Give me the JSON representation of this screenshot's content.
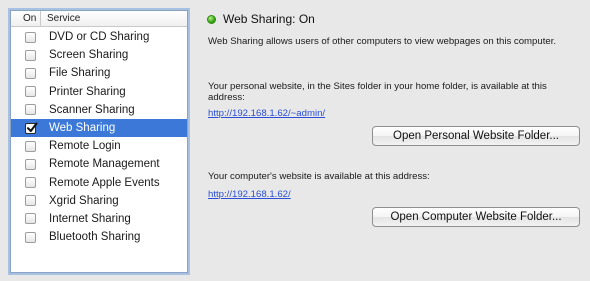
{
  "services_list": {
    "header": {
      "on_label": "On",
      "service_label": "Service"
    },
    "items": [
      {
        "label": "DVD or CD Sharing",
        "checked": false,
        "selected": false
      },
      {
        "label": "Screen Sharing",
        "checked": false,
        "selected": false
      },
      {
        "label": "File Sharing",
        "checked": false,
        "selected": false
      },
      {
        "label": "Printer Sharing",
        "checked": false,
        "selected": false
      },
      {
        "label": "Scanner Sharing",
        "checked": false,
        "selected": false
      },
      {
        "label": "Web Sharing",
        "checked": true,
        "selected": true
      },
      {
        "label": "Remote Login",
        "checked": false,
        "selected": false
      },
      {
        "label": "Remote Management",
        "checked": false,
        "selected": false
      },
      {
        "label": "Remote Apple Events",
        "checked": false,
        "selected": false
      },
      {
        "label": "Xgrid Sharing",
        "checked": false,
        "selected": false
      },
      {
        "label": "Internet Sharing",
        "checked": false,
        "selected": false
      },
      {
        "label": "Bluetooth Sharing",
        "checked": false,
        "selected": false
      }
    ]
  },
  "detail": {
    "status_text": "Web Sharing: On",
    "status_color": "#3fae1c",
    "description": "Web Sharing allows users of other computers to view webpages on this computer.",
    "personal_text": "Your personal website, in the Sites folder in your home folder, is available at this address:",
    "personal_url": "http://192.168.1.62/~admin/",
    "personal_button": "Open Personal Website Folder...",
    "computer_text": "Your computer's website is available at this address:",
    "computer_url": "http://192.168.1.62/",
    "computer_button": "Open Computer Website Folder..."
  },
  "colors": {
    "selection": "#3b78d7",
    "link": "#2a4fd6",
    "background": "#e8e8e8"
  }
}
